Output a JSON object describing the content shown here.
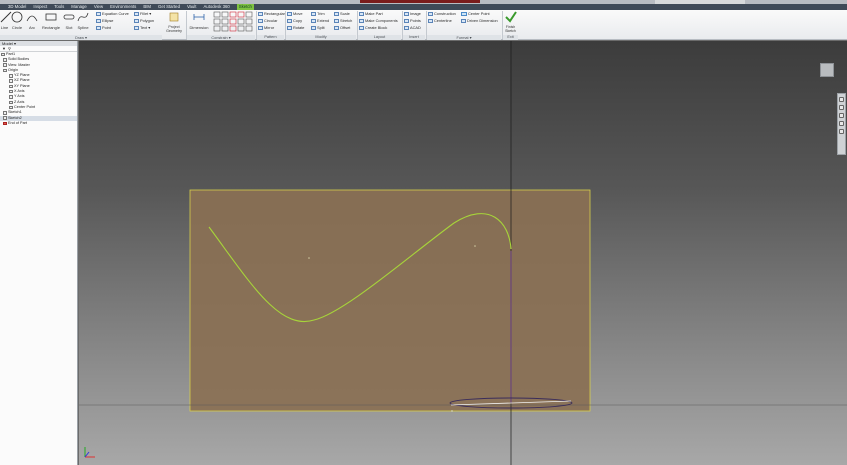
{
  "app": {
    "tabs": [
      "3D Model",
      "Inspect",
      "Tools",
      "Manage",
      "View",
      "Environments",
      "BIM",
      "Get Started",
      "Vault",
      "Autodesk 360",
      "Sketch"
    ],
    "active_tab": "Sketch"
  },
  "ribbon": {
    "draw": {
      "label": "Draw ▾",
      "big_buttons": [
        "Line",
        "Circle",
        "Arc",
        "Rectangle",
        "Slot",
        "Spline"
      ],
      "small": [
        "Equation Curve",
        "Ellipse",
        "Point",
        "Fillet ▾",
        "Polygon",
        "Text ▾"
      ],
      "project": "Project Geometry"
    },
    "constrain": {
      "label": "Constrain ▾",
      "dimension": "Dimension"
    },
    "pattern": {
      "label": "Pattern",
      "items": [
        "Rectangular",
        "Circular",
        "Mirror"
      ]
    },
    "modify": {
      "label": "Modify",
      "items": [
        "Move",
        "Trim",
        "Scale",
        "Copy",
        "Extend",
        "Stretch",
        "Rotate",
        "Split",
        "Offset"
      ]
    },
    "layout": {
      "label": "Layout",
      "items": [
        "Make Part",
        "Make Components",
        "Create Block"
      ]
    },
    "insert": {
      "label": "Insert",
      "items": [
        "Image",
        "Points",
        "ACAD"
      ]
    },
    "format": {
      "label": "Format ▾",
      "items": [
        "Construction",
        "Centerline",
        "Center Point",
        "Driven Dimension"
      ]
    },
    "exit": {
      "label": "Exit",
      "button": "Finish Sketch"
    }
  },
  "browser": {
    "header": "Model ▾",
    "items": [
      "Part1",
      "Solid Bodies",
      "View: Master",
      "Origin",
      "YZ Plane",
      "XZ Plane",
      "XY Plane",
      "X Axis",
      "Y Axis",
      "Z Axis",
      "Center Point",
      "Sketch1",
      "Sketch2",
      "End of Part"
    ],
    "selected": "Sketch2"
  },
  "colors": {
    "sketch_curve": "#a7d43a",
    "sketch_plane_fill": "#8a7054",
    "sketch_plane_border": "#d8cf4a",
    "ribbon_bg": "#f2f3f5",
    "tab_bar": "#3f4a58"
  }
}
